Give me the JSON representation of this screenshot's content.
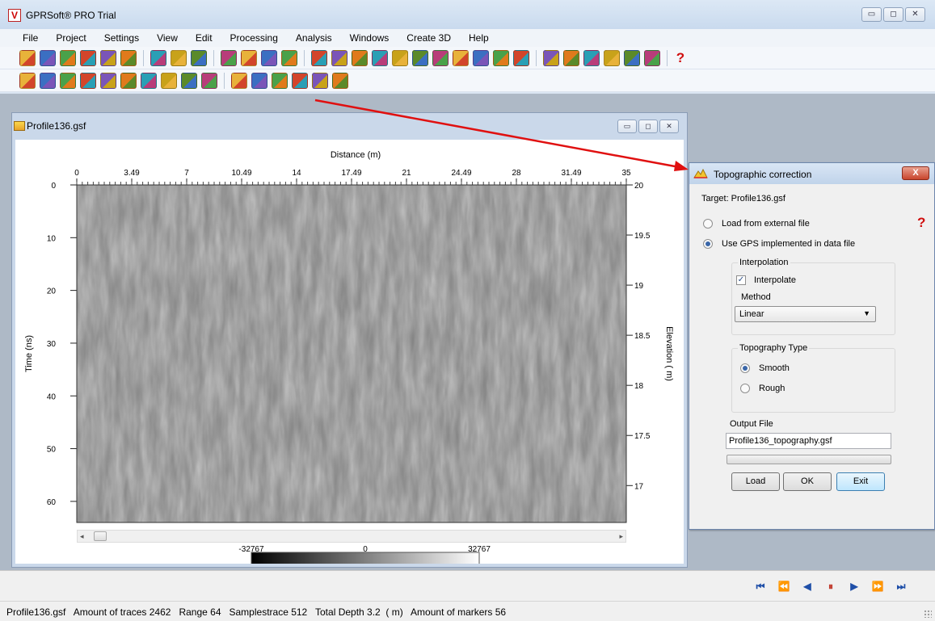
{
  "app": {
    "title": "GPRSoft® PRO Trial"
  },
  "window_controls": {
    "minimize": "▭",
    "maximize": "◻",
    "close": "✕"
  },
  "menu": [
    "File",
    "Project",
    "Settings",
    "View",
    "Edit",
    "Processing",
    "Analysis",
    "Windows",
    "Create 3D",
    "Help"
  ],
  "toolbar1_icons": [
    "open-folder-icon",
    "save-icon",
    "save-as-icon",
    "print-icon",
    "pdf-icon",
    "camera-icon",
    "sep",
    "check-tool-icon",
    "check-list-icon",
    "notes-icon",
    "sep",
    "profile-view-icon",
    "profile-list-icon",
    "table-icon",
    "settings-network-icon",
    "sep",
    "undo-icon",
    "redo-icon",
    "arc-tool-icon",
    "pen-tool-icon",
    "numbers-icon",
    "scissors-icon",
    "grid-image-icon",
    "arrows-icon",
    "refresh-icon",
    "grid-icon",
    "draw-icon",
    "sep",
    "palette-icon",
    "zoom-icon",
    "tree-icon",
    "layers-icon",
    "peaks-icon",
    "exit-icon",
    "sep",
    "help-icon"
  ],
  "toolbar2_icons": [
    "filter-icon",
    "note-icon",
    "funnel-icon",
    "antenna-icon",
    "cross-icon",
    "comb-icon",
    "epsilon-icon",
    "binary-icon",
    "branch-icon",
    "hyperbola-icon",
    "sep",
    "pointer-icon",
    "topography-icon",
    "tree-branch-icon",
    "layers-stack-icon",
    "stacked-colors-icon",
    "monitor-icon"
  ],
  "child_window": {
    "title": "Profile136.gsf",
    "xaxis_title": "Distance (m)",
    "xticks": [
      "0",
      "3.49",
      "7",
      "10.49",
      "14",
      "17.49",
      "21",
      "24.49",
      "28",
      "31.49",
      "35"
    ],
    "yaxis_left_title": "Time (ns)",
    "yticks_left": [
      "0",
      "10",
      "20",
      "30",
      "40",
      "50",
      "60"
    ],
    "yaxis_right_title": "Elevation ( m)",
    "yticks_right": [
      "20",
      "19.5",
      "19",
      "18.5",
      "18",
      "17.5",
      "17"
    ],
    "colorbar": {
      "min": "-32767",
      "mid": "0",
      "max": "32767"
    },
    "scroll_left": "◂",
    "scroll_right": "▸"
  },
  "dialog": {
    "title": "Topographic correction",
    "close": "X",
    "target": "Target: Profile136.gsf",
    "help": "?",
    "source_options": [
      {
        "label": "Load from external file",
        "selected": false
      },
      {
        "label": "Use GPS implemented in data file",
        "selected": true
      }
    ],
    "interpolation": {
      "group_label": "Interpolation",
      "checkbox_label": "Interpolate",
      "checked": true,
      "method_label": "Method",
      "method_value": "Linear"
    },
    "topography": {
      "group_label": "Topography Type",
      "options": [
        {
          "label": "Smooth",
          "selected": true
        },
        {
          "label": "Rough",
          "selected": false
        }
      ]
    },
    "output_label": "Output File",
    "output_value": "Profile136_topography.gsf",
    "progress": 0,
    "buttons": {
      "load": "Load",
      "ok": "OK",
      "exit": "Exit"
    }
  },
  "nav_buttons": [
    "⏮",
    "⏪",
    "◀",
    "⏸",
    "▶",
    "⏩",
    "⏭"
  ],
  "status": "Profile136.gsf   Amount of traces 2462   Range 64   Samplestrace 512   Total Depth 3.2  ( m)   Amount of markers 56"
}
